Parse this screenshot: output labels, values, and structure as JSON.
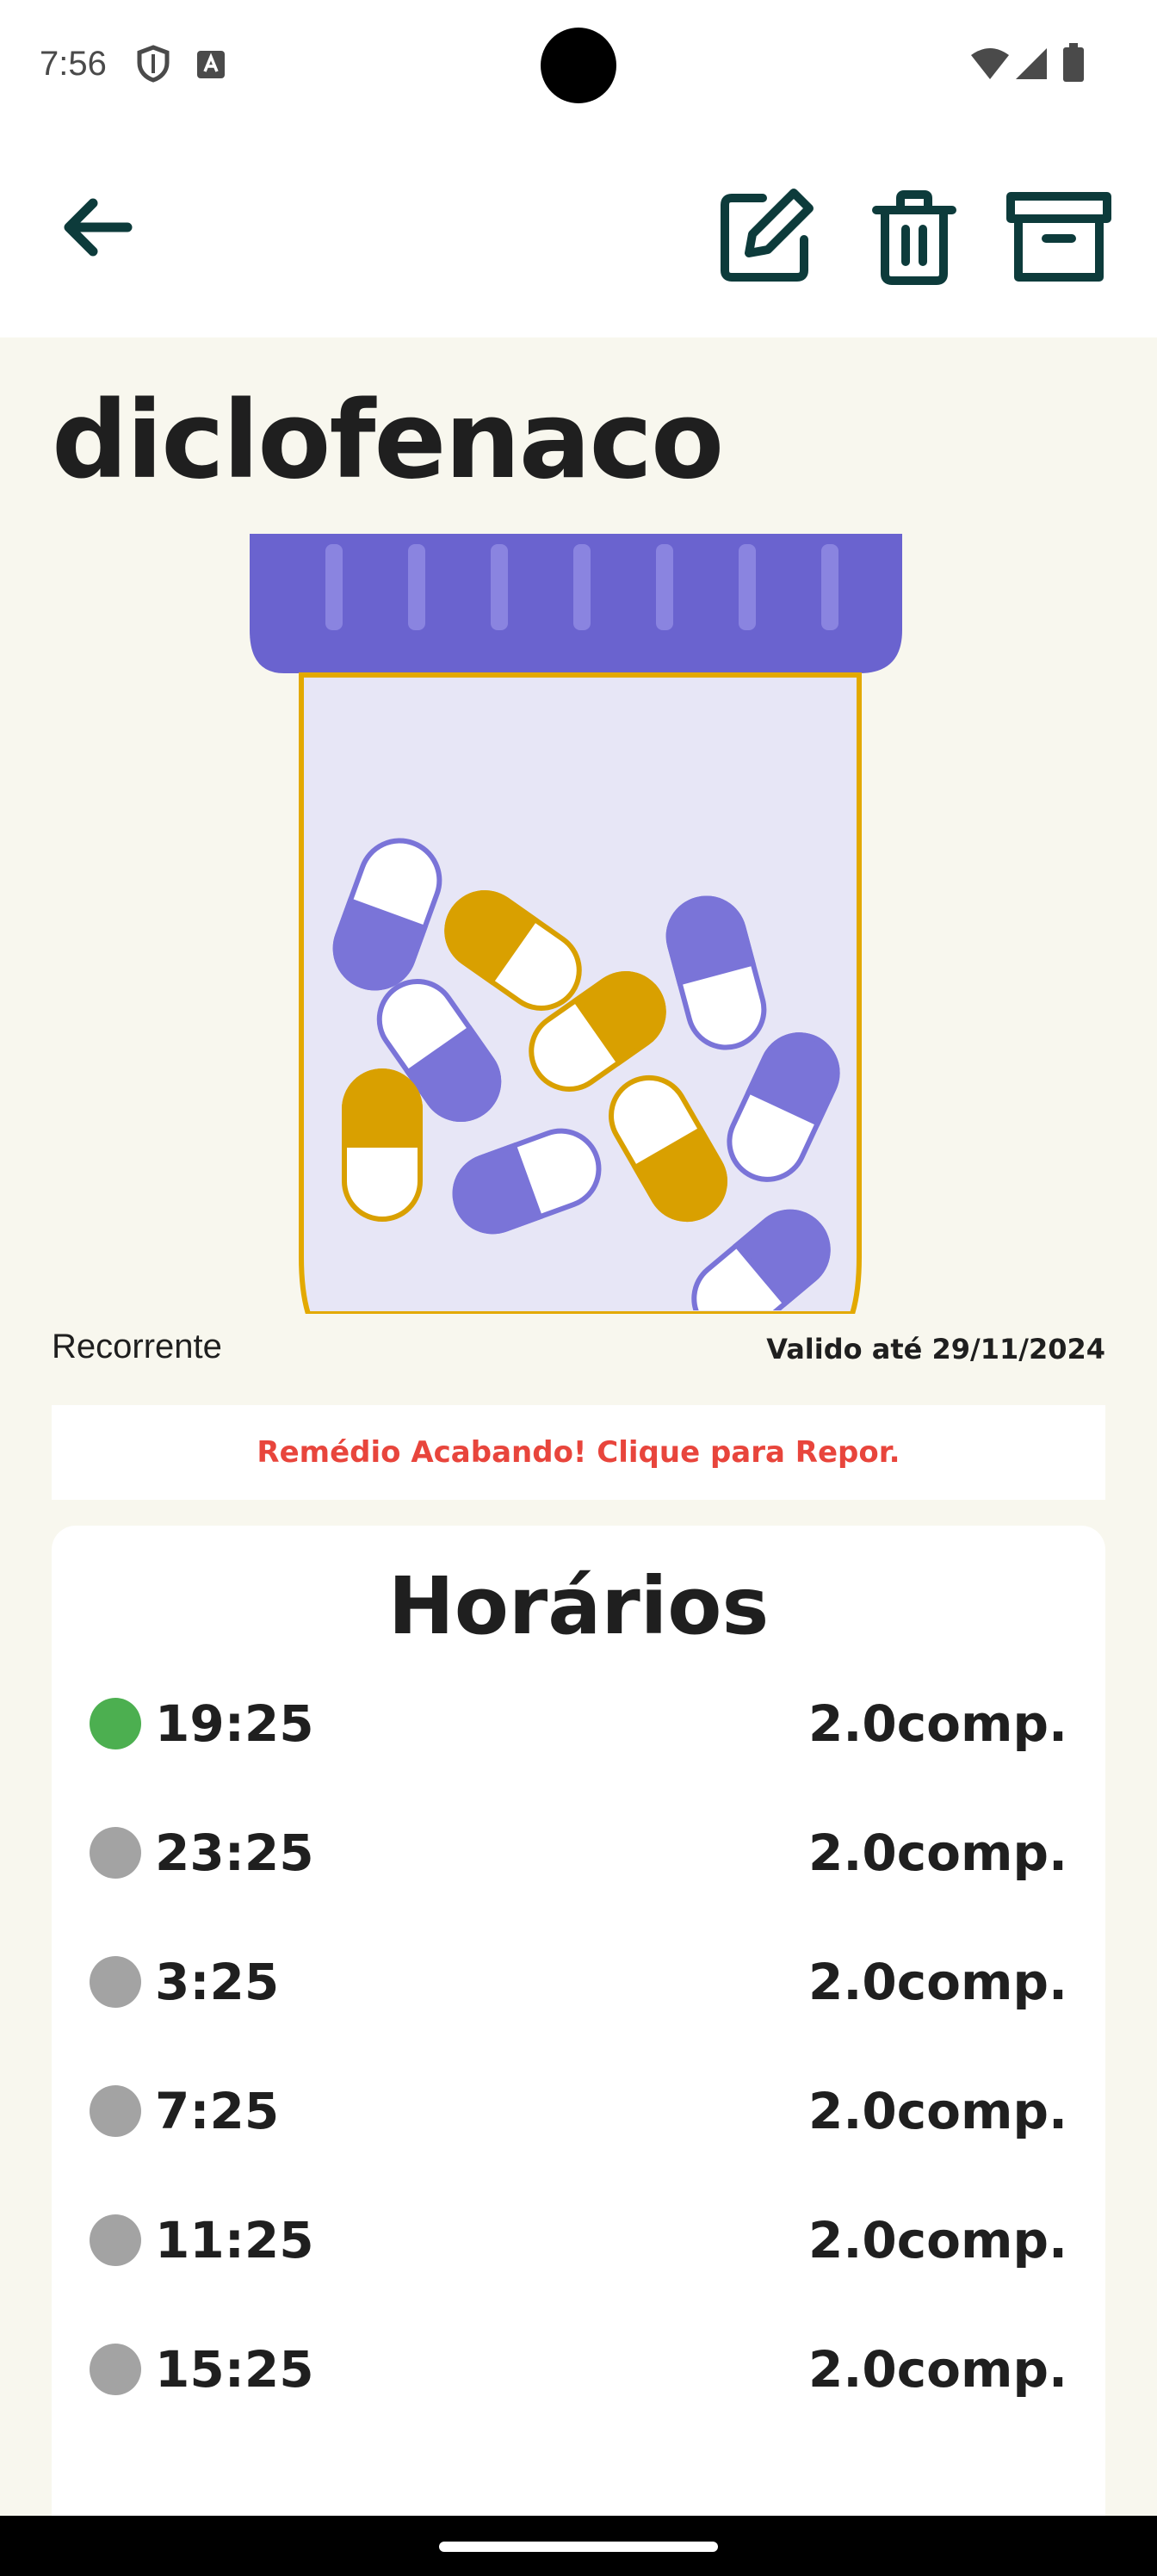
{
  "status_bar": {
    "time": "7:56",
    "left_icons": [
      "shield-icon",
      "keyboard-a-icon"
    ],
    "right_icons": [
      "wifi-icon",
      "signal-icon",
      "battery-icon"
    ]
  },
  "app_bar": {
    "icons": [
      "back-arrow-icon",
      "edit-icon",
      "trash-icon",
      "archive-icon"
    ],
    "icon_color": "#0d3b3b"
  },
  "medicine": {
    "name": "diclofenaco",
    "type": "Recorrente",
    "valid_until": "Valido até 29/11/2024",
    "alert": "Remédio Acabando! Clique para Repor."
  },
  "schedule": {
    "title": "Horários",
    "items": [
      {
        "time": "19:25",
        "qty": "2.0comp.",
        "active": true
      },
      {
        "time": "23:25",
        "qty": "2.0comp.",
        "active": false
      },
      {
        "time": "3:25",
        "qty": "2.0comp.",
        "active": false
      },
      {
        "time": "7:25",
        "qty": "2.0comp.",
        "active": false
      },
      {
        "time": "11:25",
        "qty": "2.0comp.",
        "active": false
      },
      {
        "time": "15:25",
        "qty": "2.0comp.",
        "active": false
      }
    ]
  },
  "colors": {
    "background": "#f8f7ee",
    "accent_purple": "#6a63cf",
    "pill_purple": "#7a74d8",
    "pill_gold": "#d9a000",
    "alert_red": "#e8453c",
    "active_green": "#4caf50",
    "inactive_gray": "#a3a3a3"
  }
}
